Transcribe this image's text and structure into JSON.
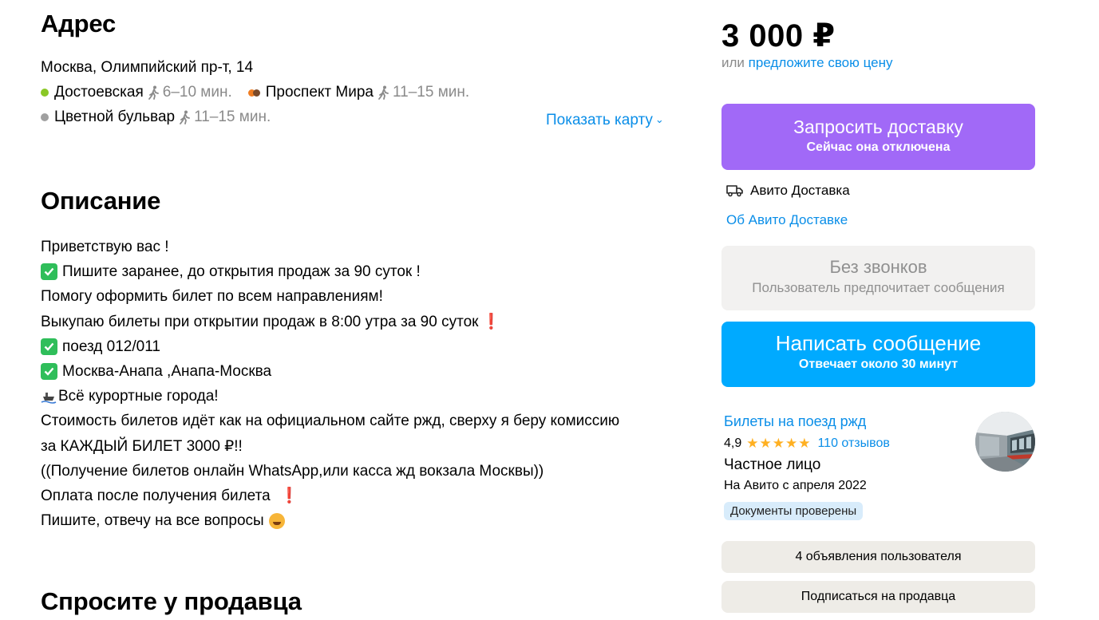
{
  "address": {
    "title": "Адрес",
    "line": "Москва, Олимпийский пр-т, 14",
    "metro": [
      {
        "name": "Достоевская",
        "time": "6–10 мин.",
        "colors": [
          "#8ac826"
        ]
      },
      {
        "name": "Проспект Мира",
        "time": "11–15 мин.",
        "colors": [
          "#7b4a2a",
          "#f07d22"
        ]
      },
      {
        "name": "Цветной бульвар",
        "time": "11–15 мин.",
        "colors": [
          "#a0a0a0"
        ]
      }
    ],
    "show_map": "Показать карту",
    "walk_icon": "walking-person-icon"
  },
  "description": {
    "title": "Описание",
    "lines": [
      "Приветствую вас !",
      "Пишите заранее, до открытия продаж за 90 суток !",
      "Помогу оформить билет по всем направлениям!",
      "Выкупаю билеты при открытии продаж в 8:00 утра за 90 суток",
      "поезд 012/011",
      "Москва-Анапа ,Анапа-Москва",
      "Всё курортные города!",
      "Стоимость билетов идёт как на официальном сайте ржд, сверху я беру комиссию",
      "за КАЖДЫЙ БИЛЕТ 3000 ₽!!",
      "((Получение билетов онлайн WhatsApp,или касса жд вокзала Москвы))",
      "Оплата после получения билета",
      "Пишите, отвечу на все вопросы"
    ]
  },
  "ask_seller": {
    "title": "Спросите у продавца"
  },
  "sidebar": {
    "price": "3 000 ₽",
    "offer_prefix": "или",
    "offer_link": "предложите свою цену",
    "delivery_button": {
      "title": "Запросить доставку",
      "subtitle": "Сейчас она отключена",
      "color": "#a169f7"
    },
    "delivery_label": "Авито Доставка",
    "about_delivery": "Об Авито Доставке",
    "no_calls": {
      "title": "Без звонков",
      "subtitle": "Пользователь предпочитает сообщения"
    },
    "message_button": {
      "title": "Написать сообщение",
      "subtitle": "Отвечает около 30 минут",
      "color": "#00aaff"
    },
    "seller": {
      "name": "Билеты на поезд ржд",
      "rating": "4,9",
      "stars": "★★★★★",
      "reviews": "110 отзывов",
      "type": "Частное лицо",
      "since": "На Авито с апреля 2022",
      "badge": "Документы проверены"
    },
    "ads_button": "4 объявления пользователя",
    "subscribe_button": "Подписаться на продавца"
  }
}
